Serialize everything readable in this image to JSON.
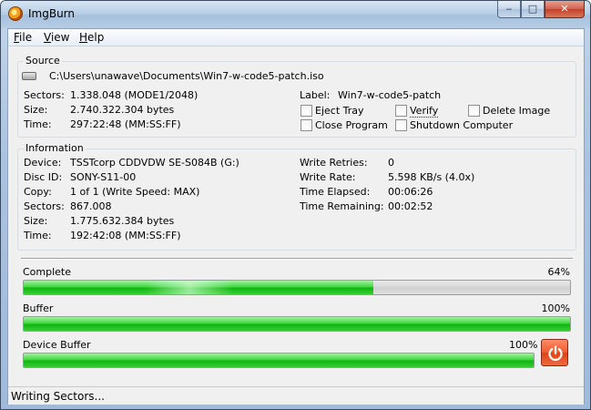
{
  "window": {
    "title": "ImgBurn",
    "min_glyph": "‒",
    "max_glyph": "□",
    "close_glyph": "✕"
  },
  "menu": {
    "file": {
      "acc": "F",
      "rest": "ile"
    },
    "view": {
      "acc": "V",
      "rest": "iew"
    },
    "help": {
      "acc": "H",
      "rest": "elp"
    }
  },
  "source": {
    "title": "Source",
    "path": "C:\\Users\\unawave\\Documents\\Win7-w-code5-patch.iso",
    "sectors_label": "Sectors:",
    "sectors": "1.338.048 (MODE1/2048)",
    "size_label": "Size:",
    "size": "2.740.322.304 bytes",
    "time_label": "Time:",
    "time": "297:22:48 (MM:SS:FF)",
    "volume_label_label": "Label:",
    "volume_label": "Win7-w-code5-patch",
    "options": {
      "eject_tray": "Eject Tray",
      "verify": "Verify",
      "delete_image": "Delete Image",
      "close_program": "Close Program",
      "shutdown_computer": "Shutdown Computer"
    }
  },
  "information": {
    "title": "Information",
    "device_label": "Device:",
    "device": "TSSTcorp CDDVDW SE-S084B (G:)",
    "disc_id_label": "Disc ID:",
    "disc_id": "SONY-S11-00",
    "copy_label": "Copy:",
    "copy": "1 of 1 (Write Speed: MAX)",
    "sectors_label": "Sectors:",
    "sectors": "867.008",
    "size_label": "Size:",
    "size": "1.775.632.384 bytes",
    "time_label": "Time:",
    "time": "192:42:08 (MM:SS:FF)",
    "write_retries_label": "Write Retries:",
    "write_retries": "0",
    "write_rate_label": "Write Rate:",
    "write_rate": "5.598 KB/s (4.0x)",
    "time_elapsed_label": "Time Elapsed:",
    "time_elapsed": "00:06:26",
    "time_remaining_label": "Time Remaining:",
    "time_remaining": "00:02:52"
  },
  "progress": {
    "complete": {
      "label": "Complete",
      "percent_text": "64%",
      "value": 0.64
    },
    "buffer": {
      "label": "Buffer",
      "percent_text": "100%",
      "value": 1.0
    },
    "device_buffer": {
      "label": "Device Buffer",
      "percent_text": "100%",
      "value": 1.0
    }
  },
  "status": {
    "text": "Writing Sectors..."
  },
  "colors": {
    "progress_green": "#1ebf1e",
    "power_button": "#e8481f"
  },
  "icons": {
    "drive": "optical-drive-icon",
    "power": "power-icon",
    "app": "imgburn-icon"
  }
}
